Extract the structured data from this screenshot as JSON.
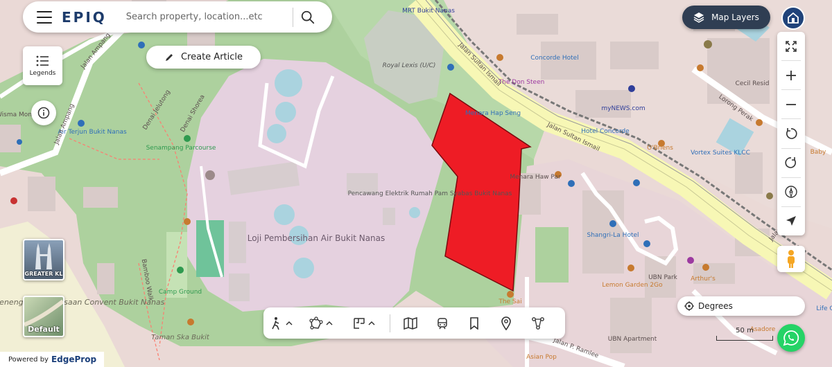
{
  "header": {
    "logo_text": "EPIQ",
    "search_placeholder": "Search property, location...etc"
  },
  "controls": {
    "legends_label": "Legends",
    "create_article_label": "Create Article",
    "map_layers_label": "Map Layers",
    "degrees_label": "Degrees",
    "scale_label": "50 m",
    "powered_by_label": "Powered by",
    "edgeprop_label": "EdgeProp"
  },
  "basemap_tiles": [
    {
      "label": "GREATER KL"
    },
    {
      "label": "Default"
    }
  ],
  "map_labels": {
    "mrt": "MRT Bukit Nanas",
    "royal_lexis": "Royal Lexis (U/C)",
    "jalan_sultan_ismail_1": "Jalan Sultan Ismail",
    "jalan_sultan_ismail_2": "Jalan Sultan Ismail",
    "concorde": "Concorde Hotel",
    "the_don": "The Don Steen",
    "menara_hap_seng": "Menara Hap Seng",
    "mynews": "myNEWS.com",
    "hotel_concorde": "Hotel Concorde",
    "obriens": "O'Briens",
    "vortex": "Vortex Suites KLCC",
    "lorong_perak": "Lorong Perak",
    "cecil": "Cecil Resid",
    "baby": "Baby",
    "jalan_ampang_1": "Jalan Ampang",
    "jalan_ampang_2": "Jalan Ampang",
    "denai_jelutong": "Denai Jelutong",
    "denai_shorea": "Denai Shorea",
    "wisma_monie": "Wisma Monie",
    "air_terjun": "Air Terjun Bukit Nanas",
    "senampang": "Senampang Parcourse",
    "loji": "Loji Pembersihan Air Bukit Nanas",
    "pencawang": "Pencawang Elektrik Rumah Pam Syabas Bukit Nanas",
    "menara_haw_par": "Menara Haw Par",
    "shangri_la": "Shangri-La Hotel",
    "ubn_park": "UBN Park",
    "arthurs": "Arthur's",
    "lemon_garden": "Lemon Garden 2Go",
    "ubn_apartment": "UBN Apartment",
    "the_sai": "The Sai",
    "camp_ground": "Camp Ground",
    "bamboo_walk": "Bamboo Walk",
    "convent": "Sekolah Menengah Kebangsaan Convent Bukit Nanas",
    "taman": "Taman Ska Bukit",
    "jalan_p_ramlee": "Jalan P. Ramlee",
    "asian_pop": "Asian Pop",
    "asadore": "Asadore",
    "life_centre": "Life C",
    "jalan_x": "Jalan"
  },
  "highlight": {
    "fill_color": "#ee1c25"
  }
}
